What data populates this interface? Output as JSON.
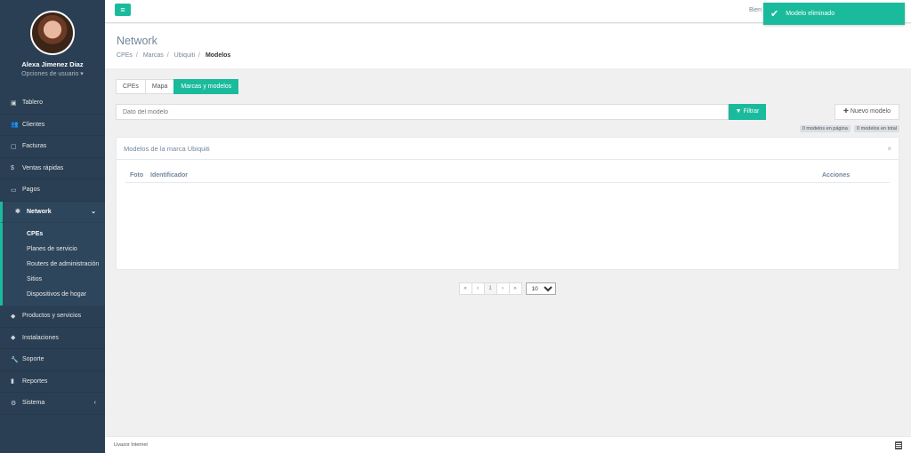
{
  "user": {
    "name": "Alexa Jimenez Diaz",
    "options": "Opciones de usuario ▾"
  },
  "menu": [
    {
      "label": "Tablero",
      "icon": "dashboard-icon",
      "glyph": "▣"
    },
    {
      "label": "Clientes",
      "icon": "users-icon",
      "glyph": "👥"
    },
    {
      "label": "Facturas",
      "icon": "file-icon",
      "glyph": "▢"
    },
    {
      "label": "Ventas rápidas",
      "icon": "dollar-icon",
      "glyph": "$"
    },
    {
      "label": "Pagos",
      "icon": "money-icon",
      "glyph": "▭"
    },
    {
      "label": "Network",
      "icon": "snowflake-icon",
      "glyph": "✱"
    },
    {
      "label": "Productos y servicios",
      "icon": "tag-icon",
      "glyph": "◆"
    },
    {
      "label": "Instalaciones",
      "icon": "tag-icon",
      "glyph": "◆"
    },
    {
      "label": "Soporte",
      "icon": "wrench-icon",
      "glyph": "🔧"
    },
    {
      "label": "Reportes",
      "icon": "book-icon",
      "glyph": "▮"
    },
    {
      "label": "Sistema",
      "icon": "cogs-icon",
      "glyph": "⚙"
    }
  ],
  "submenu": [
    "CPEs",
    "Planes de servicio",
    "Routers de administración",
    "Sitios",
    "Dispositivos de hogar"
  ],
  "topbar": {
    "welcome": "Bien",
    "toast": "Modelo eliminado"
  },
  "page": {
    "title": "Network",
    "breadcrumb": [
      "CPEs",
      "Marcas",
      "Ubiquiti",
      "Modelos"
    ]
  },
  "tabs": [
    "CPEs",
    "Mapa",
    "Marcas y modelos"
  ],
  "filter": {
    "placeholder": "Dato del modelo",
    "button": "Filtrar",
    "new_button": "Nuevo modelo"
  },
  "counts": {
    "page": "0 modelos en página",
    "total": "0 modelos en total"
  },
  "panel": {
    "title": "Modelos de la marca Ubiquiti",
    "close": "×",
    "columns": [
      "Foto",
      "Identificador",
      "Acciones"
    ]
  },
  "pager": {
    "first": "«",
    "prev": "‹",
    "page": "1",
    "next": "›",
    "last": "»",
    "per_page": "10"
  },
  "footer": {
    "text": "Livazor Internet"
  }
}
